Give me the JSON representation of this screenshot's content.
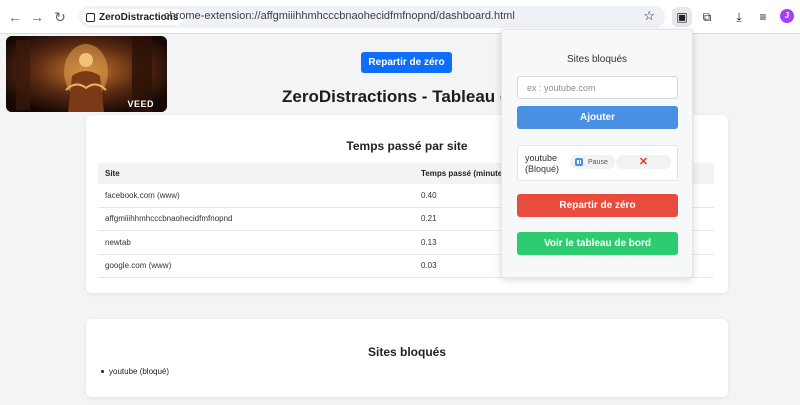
{
  "browser": {
    "site_chip": "ZeroDistractions",
    "url": "chrome-extension://affgmiiihhmhcccbnaohecidfmfnopnd/dashboard.html",
    "avatar_initial": "J",
    "icons": [
      "back-arrow-icon",
      "forward-arrow-icon",
      "reload-icon",
      "star-icon",
      "extension-popup-icon",
      "puzzle-icon",
      "download-icon",
      "media-queue-icon"
    ]
  },
  "video_overlay": {
    "watermark": "VEED"
  },
  "dashboard": {
    "reset_label": "Repartir de zéro",
    "title": "ZeroDistractions - Tableau de bord",
    "time_card": {
      "title": "Temps passé par site",
      "columns": [
        "Site",
        "Temps passé (minutes)"
      ],
      "rows": [
        {
          "site": "facebook.com (www)",
          "minutes": "0.40"
        },
        {
          "site": "affgmiiihhmhcccbnaohecidfmfnopnd",
          "minutes": "0.21"
        },
        {
          "site": "newtab",
          "minutes": "0.13"
        },
        {
          "site": "google.com (www)",
          "minutes": "0.03"
        }
      ]
    },
    "blocked_card": {
      "title": "Sites bloqués",
      "items": [
        "youtube (bloqué)"
      ]
    }
  },
  "popup": {
    "title": "Sites bloqués",
    "input_placeholder": "ex : youtube.com",
    "add_label": "Ajouter",
    "blocked_site": {
      "name": "youtube (Bloqué)",
      "pause_label": "Pause",
      "remove_symbol": "✕"
    },
    "reset_label": "Repartir de zéro",
    "dashboard_label": "Voir le tableau de bord"
  },
  "colors": {
    "primary_blue": "#0d6efd",
    "add_blue": "#4a90e2",
    "reset_red": "#e74c3c",
    "dashboard_green": "#2ecc71",
    "avatar_purple": "#a142f4"
  }
}
